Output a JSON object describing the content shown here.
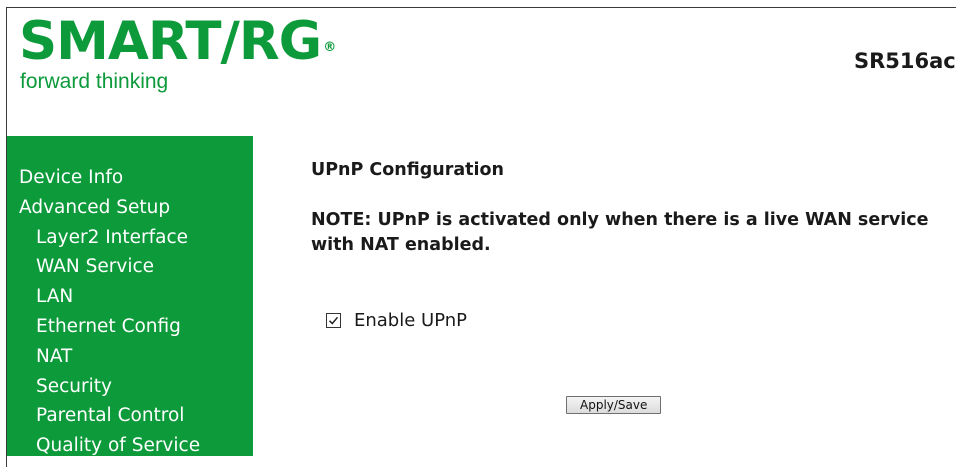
{
  "header": {
    "logo_text": "SMART/RG",
    "logo_registered": "®",
    "tagline": "forward thinking",
    "model": "SR516ac"
  },
  "sidebar": {
    "items": [
      {
        "label": "Device Info",
        "level": 0
      },
      {
        "label": "Advanced Setup",
        "level": 0
      },
      {
        "label": "Layer2 Interface",
        "level": 1
      },
      {
        "label": "WAN Service",
        "level": 1
      },
      {
        "label": "LAN",
        "level": 1
      },
      {
        "label": "Ethernet Config",
        "level": 1
      },
      {
        "label": "NAT",
        "level": 1
      },
      {
        "label": "Security",
        "level": 1
      },
      {
        "label": "Parental Control",
        "level": 1
      },
      {
        "label": "Quality of Service",
        "level": 1
      }
    ]
  },
  "main": {
    "title": "UPnP Configuration",
    "note": "NOTE: UPnP is activated only when there is a live WAN service with NAT enabled.",
    "enable_upnp": {
      "label": "Enable UPnP",
      "checked": true
    },
    "apply_label": "Apply/Save"
  },
  "colors": {
    "brand_green": "#0c9a3a",
    "sidebar_text": "#ffffff",
    "body_text": "#1a1a1a"
  },
  "icons": {
    "checkbox": "checkmark-icon"
  }
}
